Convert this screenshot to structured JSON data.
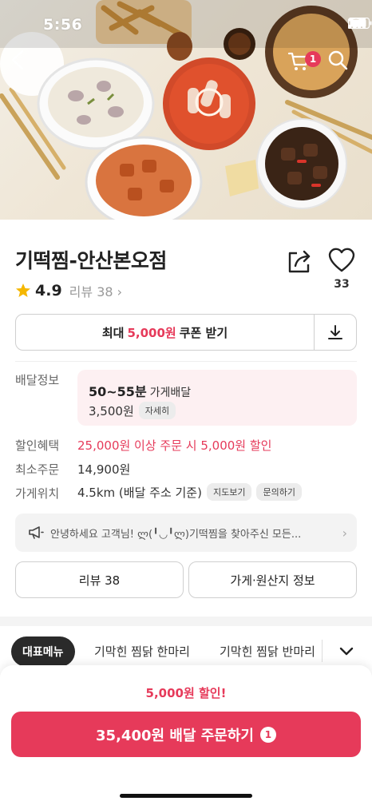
{
  "status": {
    "time": "5:56"
  },
  "header": {
    "cart_count": "1"
  },
  "store": {
    "name": "기떡찜-안산본오점",
    "rating": "4.9",
    "review_link": "리뷰 38",
    "likes": "33"
  },
  "coupon": {
    "prefix": "최대",
    "amount": "5,000원",
    "suffix": "쿠폰 받기"
  },
  "info": {
    "delivery_label": "배달정보",
    "delivery_time": "50~55분",
    "delivery_type": "가게배달",
    "delivery_fee": "3,500원",
    "detail_chip": "자세히",
    "discount_label": "할인혜택",
    "discount_value": "25,000원 이상 주문 시 5,000원 할인",
    "min_order_label": "최소주문",
    "min_order_value": "14,900원",
    "location_label": "가게위치",
    "location_value": "4.5km (배달 주소 기준)",
    "map_chip": "지도보기",
    "inquiry_chip": "문의하기"
  },
  "notice": {
    "text": "안녕하세요 고객님! ლ(╹◡╹ლ)기떡찜을 찾아주신 모든..."
  },
  "buttons": {
    "reviews": "리뷰 38",
    "store_info": "가게·원산지 정보"
  },
  "menu_tabs": [
    "대표메뉴",
    "기막힌 찜닭 한마리",
    "기막힌 찜닭 반마리"
  ],
  "bottom": {
    "discount_text": "5,000원 할인!",
    "order_label": "35,400원 배달 주문하기",
    "order_count": "1"
  },
  "colors": {
    "accent": "#e63a5a",
    "dark_tab": "#2a2a2a"
  }
}
